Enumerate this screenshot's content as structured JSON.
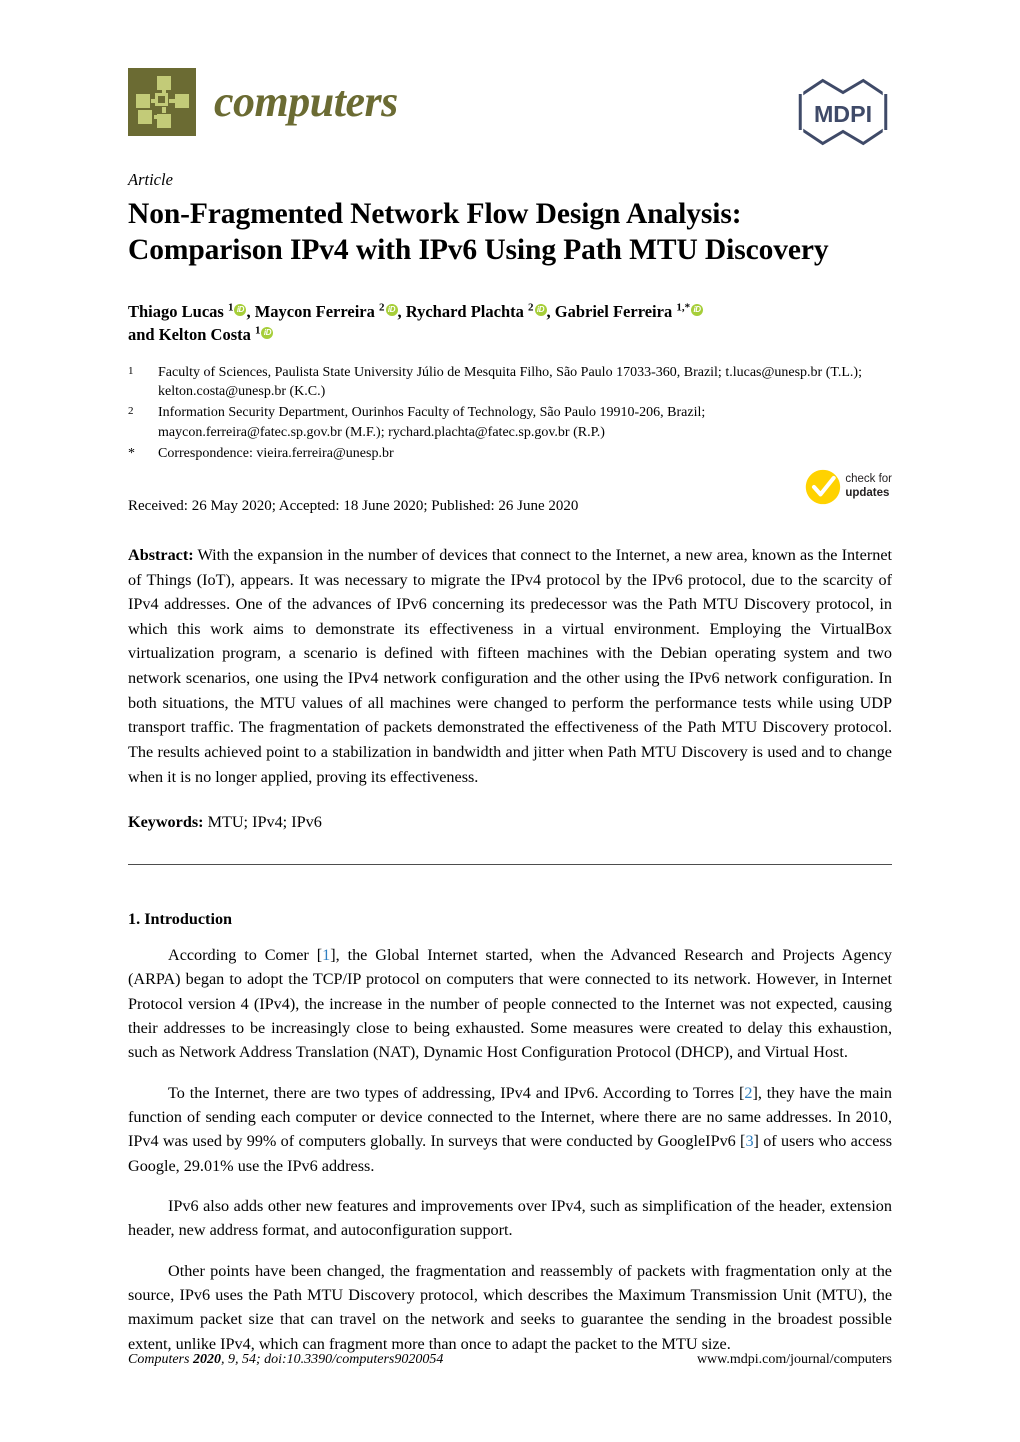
{
  "masthead": {
    "journal_name": "computers",
    "journal_logo_icon": "network-nodes-icon",
    "publisher_logo_text": "MDPI",
    "publisher_logo_icon": "mdpi-hexagon-logo",
    "brand_color": "#6b6b33",
    "brand_accent_color": "#c3cb78",
    "publisher_color": "#3f4a68"
  },
  "article": {
    "type_label": "Article",
    "title": "Non-Fragmented Network Flow Design Analysis: Comparison IPv4 with IPv6 Using Path MTU Discovery"
  },
  "authors": {
    "line1": [
      {
        "name": "Thiago Lucas",
        "sup": "1",
        "orcid": "iD",
        "sep": ", "
      },
      {
        "name": "Maycon Ferreira",
        "sup": "2",
        "orcid": "iD",
        "sep": ", "
      },
      {
        "name": "Rychard Plachta",
        "sup": "2",
        "orcid": "iD",
        "sep": ", "
      },
      {
        "name": "Gabriel Ferreira",
        "sup": "1,*",
        "orcid": "iD",
        "sep": ""
      }
    ],
    "line2_prefix": "and ",
    "line2": [
      {
        "name": "Kelton Costa",
        "sup": "1",
        "orcid": "iD",
        "sep": ""
      }
    ],
    "orcid_color": "#a6ce39"
  },
  "affiliations": [
    {
      "marker": "1",
      "text": "Faculty of Sciences, Paulista State University Júlio de Mesquita Filho, São Paulo 17033-360, Brazil; t.lucas@unesp.br (T.L.); kelton.costa@unesp.br (K.C.)"
    },
    {
      "marker": "2",
      "text": "Information Security Department, Ourinhos Faculty of Technology, São Paulo 19910-206, Brazil; maycon.ferreira@fatec.sp.gov.br (M.F.); rychard.plachta@fatec.sp.gov.br (R.P.)"
    },
    {
      "marker": "*",
      "text": "Correspondence: vieira.ferreira@unesp.br"
    }
  ],
  "dates": {
    "line": "Received: 26 May 2020; Accepted: 18 June 2020; Published: 26 June 2020"
  },
  "check_updates": {
    "icon": "check-circle-icon",
    "line1": "check for",
    "line2": "updates",
    "color": "#ffd200"
  },
  "abstract": {
    "label": "Abstract:",
    "text": "With the expansion in the number of devices that connect to the Internet, a new area, known as the Internet of Things (IoT), appears. It was necessary to migrate the IPv4 protocol by the IPv6 protocol, due to the scarcity of IPv4 addresses. One of the advances of IPv6 concerning its predecessor was the Path MTU Discovery protocol, in which this work aims to demonstrate its effectiveness in a virtual environment. Employing the VirtualBox virtualization program, a scenario is defined with fifteen machines with the Debian operating system and two network scenarios, one using the IPv4 network configuration and the other using the IPv6 network configuration. In both situations, the MTU values of all machines were changed to perform the performance tests while using UDP transport traffic. The fragmentation of packets demonstrated the effectiveness of the Path MTU Discovery protocol. The results achieved point to a stabilization in bandwidth and jitter when Path MTU Discovery is used and to change when it is no longer applied, proving its effectiveness."
  },
  "keywords": {
    "label": "Keywords:",
    "text": "MTU; IPv4; IPv6"
  },
  "introduction": {
    "heading": "1. Introduction",
    "paragraphs": [
      {
        "parts": [
          {
            "t": "According to Comer ["
          },
          {
            "t": "1",
            "cite": true
          },
          {
            "t": "], the Global Internet started, when the Advanced Research and Projects Agency (ARPA) began to adopt the TCP/IP protocol on computers that were connected to its network. However, in Internet Protocol version 4 (IPv4), the increase in the number of people connected to the Internet was not expected, causing their addresses to be increasingly close to being exhausted. Some measures were created to delay this exhaustion, such as Network Address Translation (NAT), Dynamic Host Configuration Protocol (DHCP), and Virtual Host."
          }
        ]
      },
      {
        "parts": [
          {
            "t": "To the Internet, there are two types of addressing, IPv4 and IPv6. According to Torres ["
          },
          {
            "t": "2",
            "cite": true
          },
          {
            "t": "], they have the main function of sending each computer or device connected to the Internet, where there are no same addresses. In 2010, IPv4 was used by 99% of computers globally. In surveys that were conducted by GoogleIPv6 ["
          },
          {
            "t": "3",
            "cite": true
          },
          {
            "t": "] of users who access Google, 29.01% use the IPv6 address."
          }
        ]
      },
      {
        "parts": [
          {
            "t": "IPv6 also adds other new features and improvements over IPv4, such as simplification of the header, extension header, new address format, and autoconfiguration support."
          }
        ]
      },
      {
        "parts": [
          {
            "t": "Other points have been changed, the fragmentation and reassembly of packets with fragmentation only at the source, IPv6 uses the Path MTU Discovery protocol, which describes the Maximum Transmission Unit (MTU), the maximum packet size that can travel on the network and seeks to guarantee the sending in the broadest possible extent, unlike IPv4, which can fragment more than once to adapt the packet to the MTU size."
          }
        ]
      }
    ]
  },
  "footer": {
    "journal": "Computers",
    "year": "2020",
    "citation_rest": ", 9, 54; doi:10.3390/computers9020054",
    "url": "www.mdpi.com/journal/computers"
  }
}
